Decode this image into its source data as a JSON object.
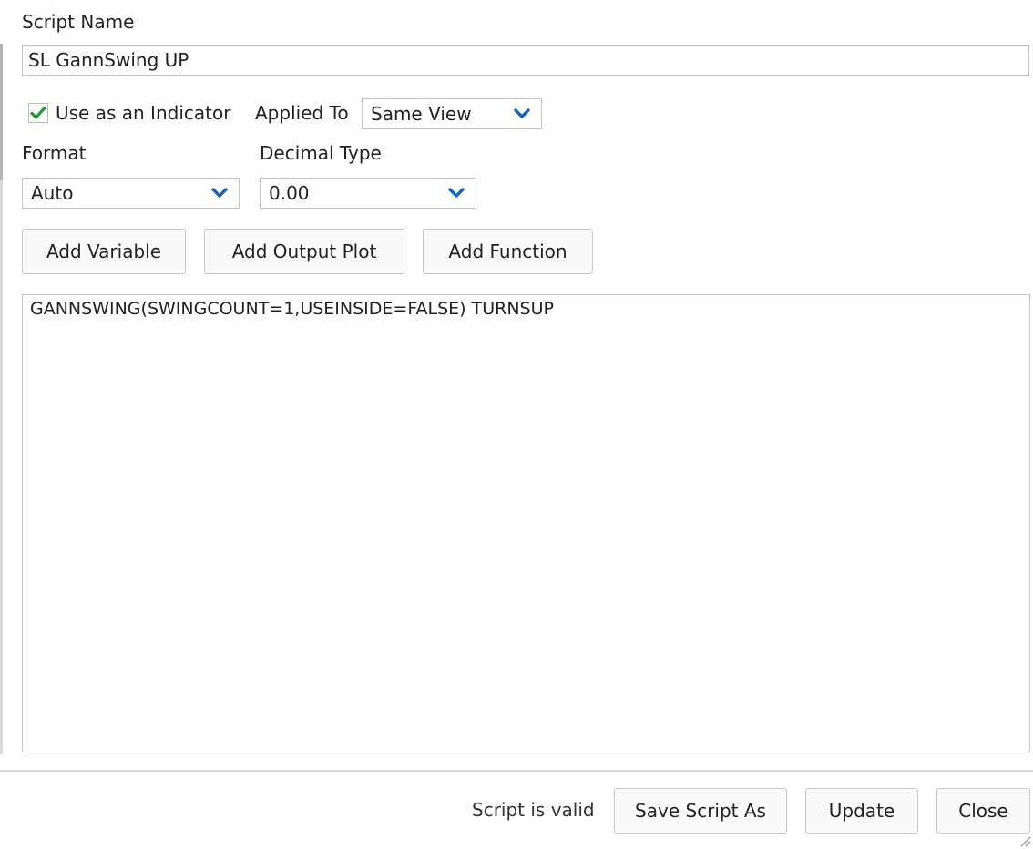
{
  "form": {
    "script_name_label": "Script Name",
    "script_name_value": "SL GannSwing UP",
    "use_as_indicator_label": "Use as an Indicator",
    "use_as_indicator_checked": true,
    "applied_to_label": "Applied To",
    "applied_to_value": "Same View",
    "format_label": "Format",
    "format_value": "Auto",
    "decimal_type_label": "Decimal Type",
    "decimal_type_value": "0.00"
  },
  "toolbar": {
    "add_variable_label": "Add Variable",
    "add_output_plot_label": "Add Output Plot",
    "add_function_label": "Add Function"
  },
  "editor": {
    "content": "GANNSWING(SWINGCOUNT=1,USEINSIDE=FALSE) TURNSUP"
  },
  "footer": {
    "status_text": "Script is valid",
    "save_script_as_label": "Save Script As",
    "update_label": "Update",
    "close_label": "Close"
  },
  "icons": {
    "checkmark": "check-icon",
    "dropdown": "chevron-down-icon",
    "resize": "resize-grip-icon"
  },
  "colors": {
    "checkmark": "#1f9d2e",
    "chevron": "#1565c0"
  }
}
